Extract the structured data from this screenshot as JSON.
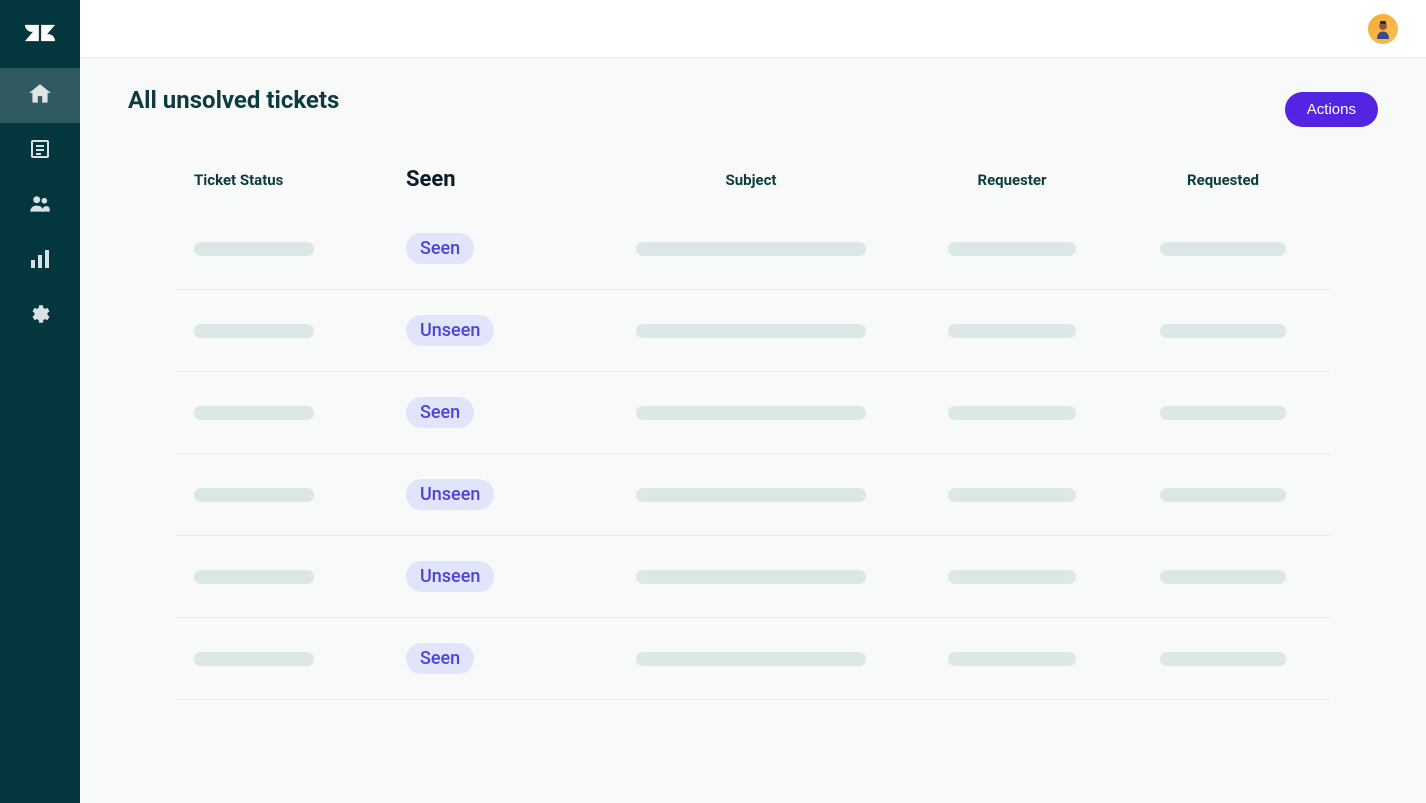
{
  "header": {
    "title": "All unsolved tickets",
    "actions_label": "Actions"
  },
  "table": {
    "columns": {
      "status": "Ticket Status",
      "seen": "Seen",
      "subject": "Subject",
      "requester": "Requester",
      "requested": "Requested"
    },
    "rows": [
      {
        "seen": "Seen"
      },
      {
        "seen": "Unseen"
      },
      {
        "seen": "Seen"
      },
      {
        "seen": "Unseen"
      },
      {
        "seen": "Unseen"
      },
      {
        "seen": "Seen"
      }
    ]
  },
  "sidebar": {
    "items": [
      {
        "name": "home",
        "active": true
      },
      {
        "name": "views",
        "active": false
      },
      {
        "name": "customers",
        "active": false
      },
      {
        "name": "reporting",
        "active": false
      },
      {
        "name": "admin",
        "active": false
      }
    ]
  },
  "colors": {
    "sidebar_bg": "#03363d",
    "sidebar_active": "#2f5a61",
    "primary_button": "#5324e2",
    "pill_bg": "#e1e4fa",
    "pill_text": "#4a45d6",
    "text_dark": "#0d3b3f",
    "placeholder": "#dce7e8"
  }
}
